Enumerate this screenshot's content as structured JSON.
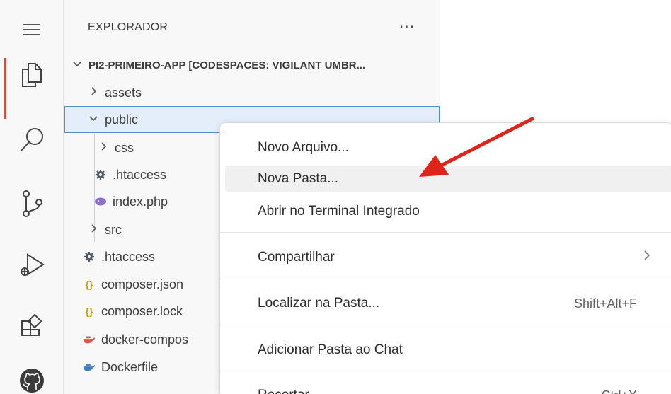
{
  "activity_bar": {
    "items": [
      "menu-icon",
      "files-icon",
      "search-icon",
      "source-control-icon",
      "run-debug-icon",
      "extensions-icon",
      "github-icon"
    ]
  },
  "explorer": {
    "title": "EXPLORADOR",
    "more": "···",
    "root": "PI2-PRIMEIRO-APP [CODESPACES: VIGILANT UMBR...",
    "items": [
      {
        "label": "assets"
      },
      {
        "label": "public"
      },
      {
        "label": "css"
      },
      {
        "label": ".htaccess"
      },
      {
        "label": "index.php"
      },
      {
        "label": "src"
      },
      {
        "label": ".htaccess"
      },
      {
        "label": "composer.json"
      },
      {
        "label": "composer.lock"
      },
      {
        "label": "docker-compos"
      },
      {
        "label": "Dockerfile"
      }
    ],
    "json_icon_glyph": "{}"
  },
  "context_menu": {
    "items": [
      {
        "label": "Novo Arquivo..."
      },
      {
        "label": "Nova Pasta..."
      },
      {
        "label": "Abrir no Terminal Integrado"
      },
      {
        "label": "Compartilhar"
      },
      {
        "label": "Localizar na Pasta...",
        "shortcut": "Shift+Alt+F"
      },
      {
        "label": "Adicionar Pasta ao Chat"
      },
      {
        "label": "Recortar",
        "shortcut": "Ctrl+X"
      }
    ]
  },
  "colors": {
    "accent_active": "#d64a3c",
    "selection_border": "#4a8fd8",
    "arrow": "#e0241b"
  }
}
